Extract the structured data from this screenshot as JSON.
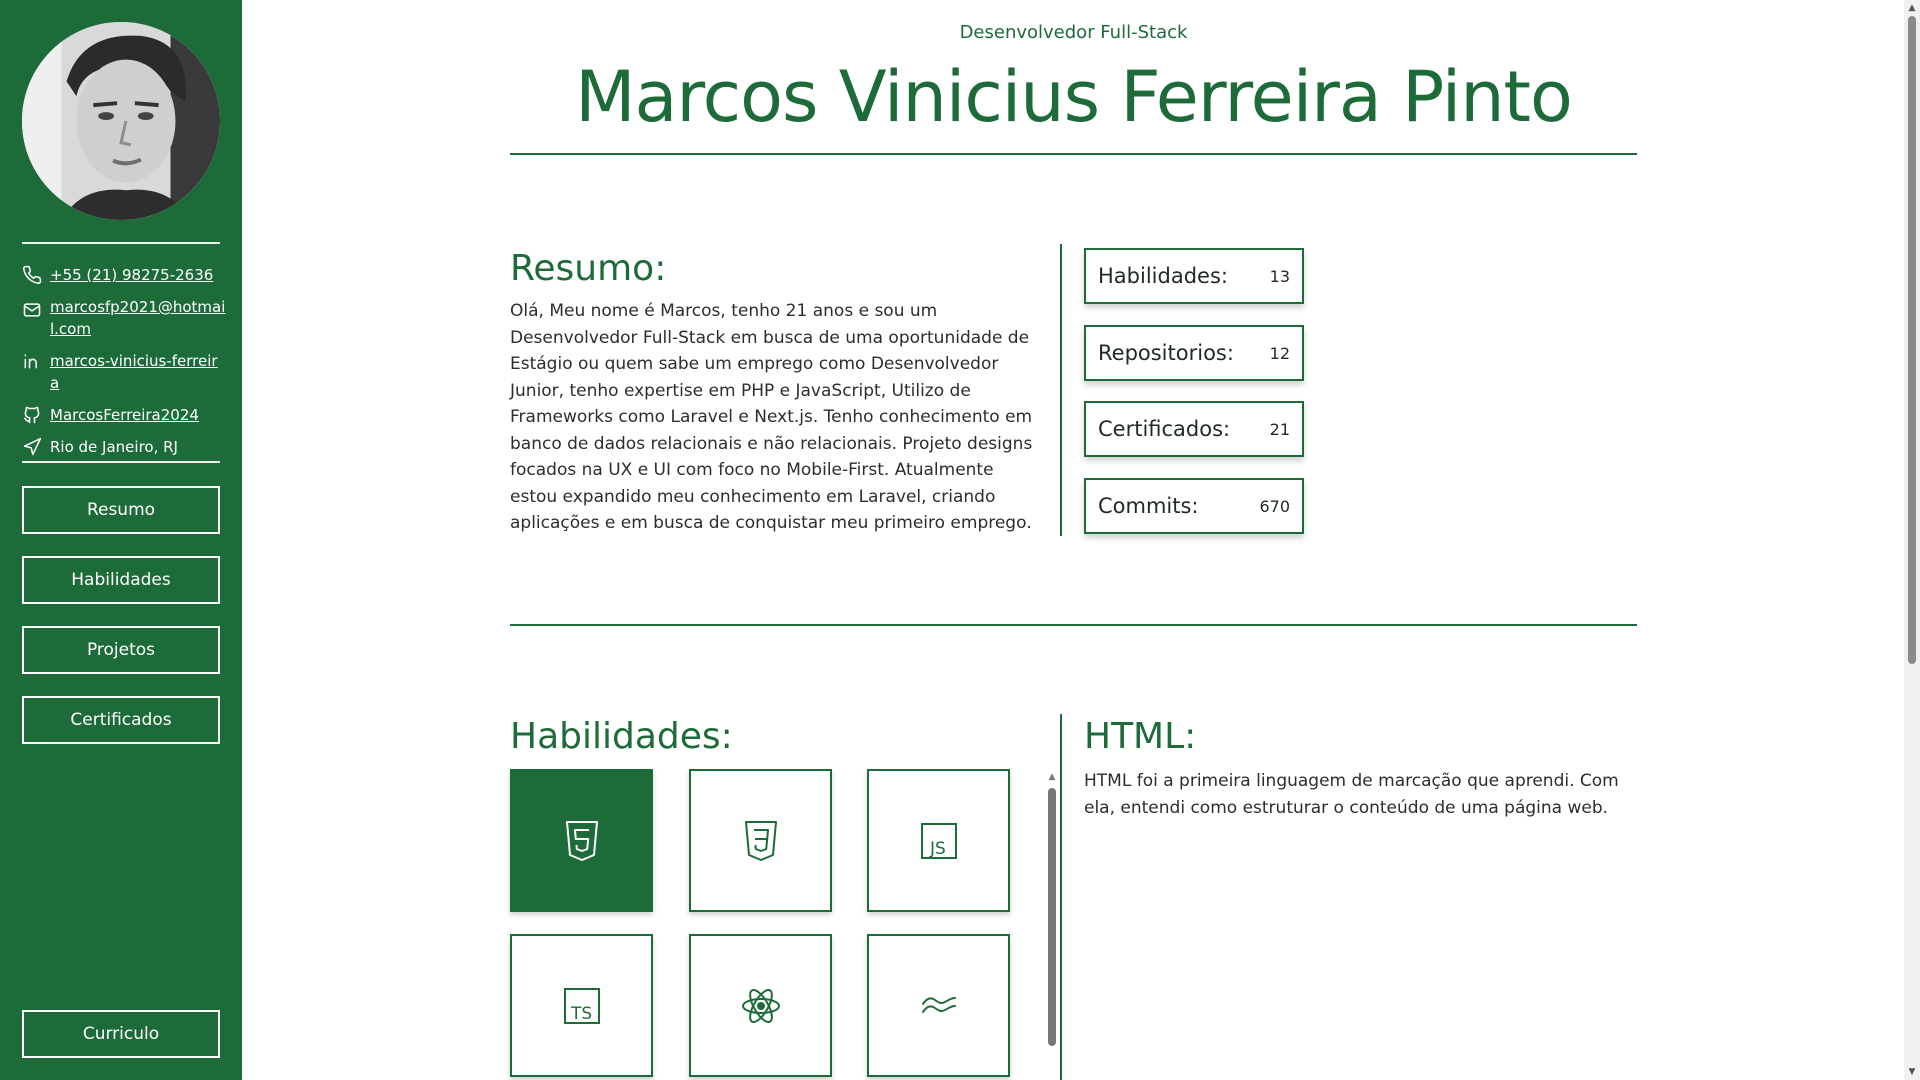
{
  "profile": {
    "role": "Desenvolvedor Full-Stack",
    "name": "Marcos Vinicius Ferreira Pinto"
  },
  "contacts": {
    "phone": "+55 (21) 98275-2636",
    "email": "marcosfp2021@hotmail.com",
    "linkedin": "marcos-vinicius-ferreira",
    "github": "MarcosFerreira2024",
    "location": "Rio de Janeiro, RJ"
  },
  "nav": {
    "resumo": "Resumo",
    "habilidades": "Habilidades",
    "projetos": "Projetos",
    "certificados": "Certificados",
    "curriculo": "Curriculo"
  },
  "resumo": {
    "title": "Resumo:",
    "text": "Olá, Meu nome é Marcos, tenho 21 anos e sou um Desenvolvedor Full-Stack em busca de uma oportunidade de Estágio ou quem sabe um emprego como Desenvolvedor Junior, tenho expertise em PHP e JavaScript, Utilizo de Frameworks como Laravel e Next.js. Tenho conhecimento em banco de dados relacionais e não relacionais. Projeto designs focados na UX e UI com foco no Mobile-First. Atualmente estou expandido meu conhecimento em Laravel, criando aplicações e em busca de conquistar meu primeiro emprego."
  },
  "stats": [
    {
      "label": "Habilidades:",
      "value": "13"
    },
    {
      "label": "Repositorios:",
      "value": "12"
    },
    {
      "label": "Certificados:",
      "value": "21"
    },
    {
      "label": "Commits:",
      "value": "670"
    }
  ],
  "skills": {
    "title": "Habilidades:",
    "items": [
      {
        "icon": "html5-icon",
        "active": true
      },
      {
        "icon": "css3-icon",
        "active": false
      },
      {
        "icon": "javascript-icon",
        "active": false
      },
      {
        "icon": "typescript-icon",
        "active": false
      },
      {
        "icon": "react-icon",
        "active": false
      },
      {
        "icon": "tailwind-icon",
        "active": false
      }
    ]
  },
  "detail": {
    "title": "HTML:",
    "text": "HTML foi a primeira linguagem de marcação que aprendi. Com ela, entendi como estruturar o conteúdo de uma página web."
  },
  "colors": {
    "brand": "#1e6b3a",
    "background": "#ffffff",
    "text": "#1f2a24"
  }
}
